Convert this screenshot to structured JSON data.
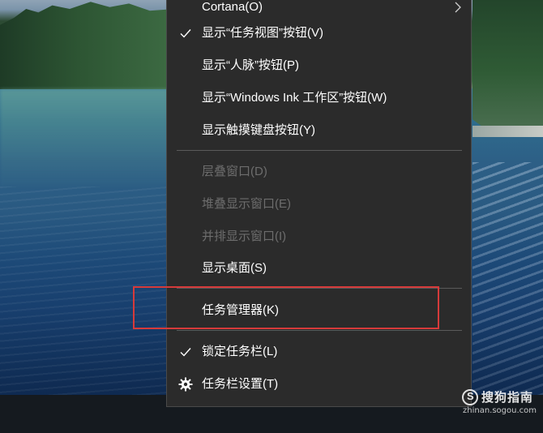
{
  "context_menu": {
    "items": [
      {
        "label": "Cortana(O)",
        "checked": false,
        "disabled": false,
        "submenu": true
      },
      {
        "label": "显示“任务视图”按钮(V)",
        "checked": true,
        "disabled": false
      },
      {
        "label": "显示“人脉”按钮(P)",
        "checked": false,
        "disabled": false
      },
      {
        "label": "显示“Windows Ink 工作区”按钮(W)",
        "checked": false,
        "disabled": false
      },
      {
        "label": "显示触摸键盘按钮(Y)",
        "checked": false,
        "disabled": false
      },
      {
        "label": "层叠窗口(D)",
        "checked": false,
        "disabled": true
      },
      {
        "label": "堆叠显示窗口(E)",
        "checked": false,
        "disabled": true
      },
      {
        "label": "并排显示窗口(I)",
        "checked": false,
        "disabled": true
      },
      {
        "label": "显示桌面(S)",
        "checked": false,
        "disabled": false
      },
      {
        "label": "任务管理器(K)",
        "checked": false,
        "disabled": false,
        "highlighted": true
      },
      {
        "label": "锁定任务栏(L)",
        "checked": true,
        "disabled": false
      },
      {
        "label": "任务栏设置(T)",
        "checked": false,
        "disabled": false,
        "icon": "gear-icon"
      }
    ]
  },
  "highlight_color": "#d63a3a",
  "watermark": {
    "text": "搜狗指南",
    "url": "zhinan.sogou.com"
  },
  "icons": [
    "checkmark-icon",
    "chevron-right-icon",
    "gear-icon",
    "sogou-logo-icon"
  ]
}
